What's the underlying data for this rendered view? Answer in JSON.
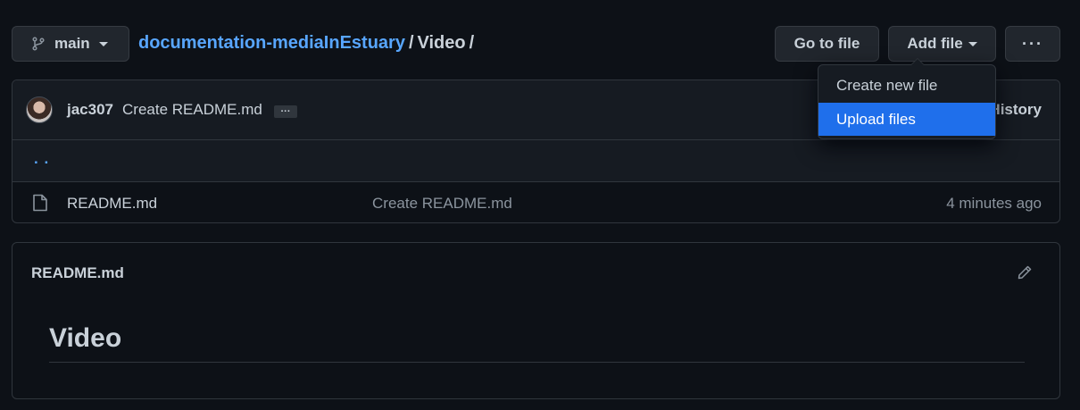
{
  "header": {
    "branch_label": "main",
    "repo_name": "documentation-mediaInEstuary",
    "separator": "/",
    "current_dir": "Video",
    "trailing_separator": "/",
    "goto_file_label": "Go to file",
    "add_file_label": "Add file",
    "more_label": "···"
  },
  "add_file_menu": {
    "items": [
      {
        "label": "Create new file"
      },
      {
        "label": "Upload files",
        "highlighted": true
      }
    ]
  },
  "latest_commit": {
    "author": "jac307",
    "message": "Create README.md",
    "expand_label": "···",
    "history_label": "History"
  },
  "parent_dir": {
    "label": ". ."
  },
  "files": [
    {
      "name": "README.md",
      "commit_message": "Create README.md",
      "age": "4 minutes ago",
      "icon": "file-icon"
    }
  ],
  "readme": {
    "filename": "README.md",
    "heading": "Video"
  },
  "colors": {
    "background": "#0d1117",
    "accent_link": "#58a6ff",
    "menu_highlight": "#1f6feb",
    "border": "#30363d"
  }
}
